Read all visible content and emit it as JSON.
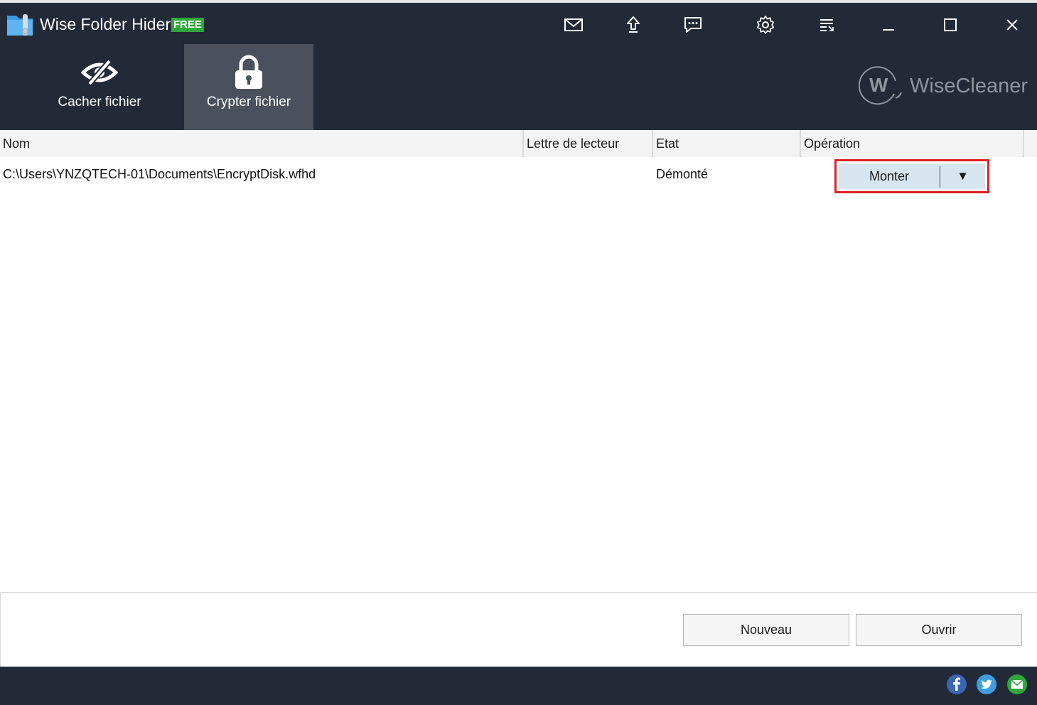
{
  "window": {
    "title": "Wise Folder Hider",
    "badge": "FREE",
    "toolbar_icons": [
      "mail-icon",
      "upload-icon",
      "feedback-icon",
      "gear-icon",
      "menu-icon",
      "minimize-icon",
      "maximize-icon",
      "close-icon"
    ]
  },
  "tabs": [
    {
      "label": "Cacher fichier",
      "icon": "eye-slash-icon",
      "active": false
    },
    {
      "label": "Crypter fichier",
      "icon": "lock-icon",
      "active": true
    }
  ],
  "brand": {
    "text": "WiseCleaner",
    "logo_letter": "W"
  },
  "table": {
    "headers": [
      "Nom",
      "Lettre de lecteur",
      "Etat",
      "Opération"
    ],
    "rows": [
      {
        "name": "C:\\Users\\YNZQTECH-01\\Documents\\EncryptDisk.wfhd",
        "drive_letter": "",
        "state": "Démonté",
        "operation": "Monter",
        "dropdown_glyph": "▼"
      }
    ]
  },
  "buttons": {
    "new": "Nouveau",
    "open": "Ouvrir"
  },
  "social": [
    "facebook-icon",
    "twitter-icon",
    "email-icon"
  ],
  "colors": {
    "header_bg": "#222a38",
    "active_tab": "#4a515c",
    "free_badge": "#2ea83a",
    "highlight_border": "#e0202a",
    "op_button_bg": "#d6e5ef"
  }
}
